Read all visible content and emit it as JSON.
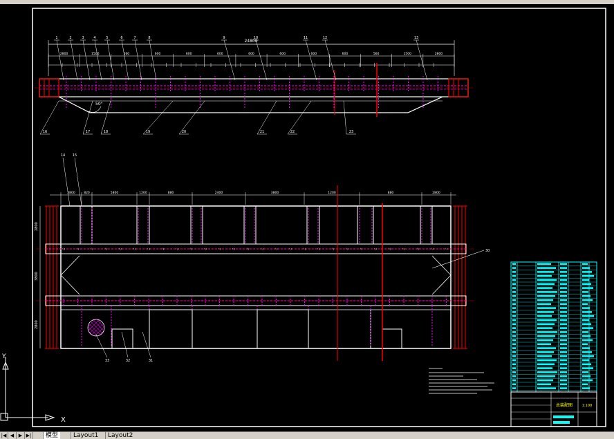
{
  "drawing": {
    "view1_dims": [
      "2800",
      "1500",
      "560",
      "600",
      "600",
      "600",
      "600",
      "600",
      "600",
      "600",
      "560",
      "1500",
      "2800"
    ],
    "view1_total": "24800",
    "view1_callouts": [
      "1",
      "2",
      "3",
      "4",
      "5",
      "6",
      "7",
      "8",
      "9",
      "10",
      "11",
      "12",
      "13"
    ],
    "view1_bottom_callouts": [
      "16",
      "17",
      "18",
      "19",
      "20",
      "21",
      "22",
      "23"
    ],
    "view2_dims": [
      "2800",
      "820",
      "5800",
      "1200",
      "880",
      "2400",
      "3800",
      "1200",
      "880",
      "2800"
    ],
    "view2_callouts": [
      "14",
      "15"
    ],
    "view2_side_callout": "30",
    "view2_bottom_callouts": [
      "33",
      "32",
      "31"
    ],
    "angle_label": "50°"
  },
  "title_block": {
    "label": "总装配图",
    "scale": "1:100"
  },
  "tabs": {
    "model": "模型",
    "layout1": "Layout1",
    "layout2": "Layout2"
  },
  "colors": {
    "background": "#000000",
    "geometry": "#ffffff",
    "hidden": "#ff00ff",
    "centerline": "#ff0000",
    "table": "#00ffff"
  }
}
